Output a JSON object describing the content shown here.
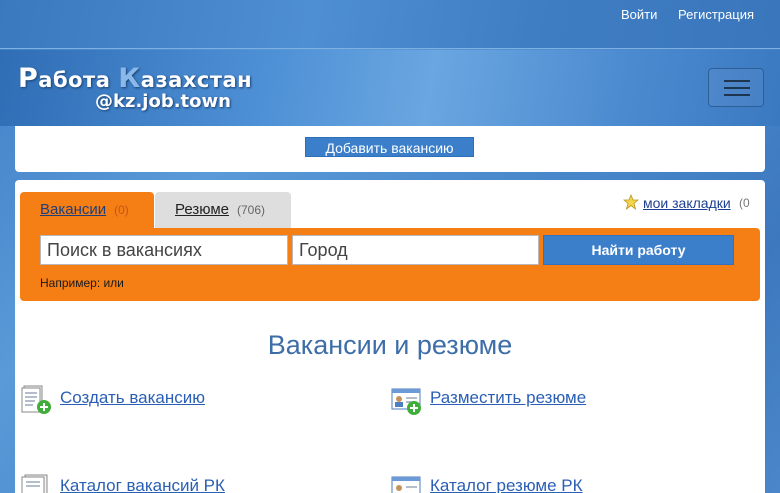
{
  "topbar": {
    "login": "Войти",
    "register": "Регистрация"
  },
  "logo": {
    "line1_first": "Р",
    "line1_rest_a": "абота ",
    "line1_k": "К",
    "line1_rest_b": "азахстан",
    "line2": "@kz.job.town"
  },
  "add_vacancy": {
    "label": "Добавить вакансию"
  },
  "tabs": [
    {
      "label": "Вакансии",
      "count": "(0)"
    },
    {
      "label": "Резюме",
      "count": "(706)"
    }
  ],
  "bookmarks": {
    "label": "мои закладки",
    "count": "(0"
  },
  "search": {
    "query_placeholder": "Поиск в вакансиях",
    "city_placeholder": "Город",
    "button": "Найти работу",
    "example": "Например:  или"
  },
  "page_title": "Вакансии и резюме",
  "actions": {
    "create_vacancy": "Создать вакансию",
    "post_resume": "Разместить резюме",
    "catalog_vacancies": "Каталог вакансий РК",
    "catalog_resumes": "Каталог резюме РК"
  },
  "icons": {
    "menu": "hamburger-icon",
    "star": "star-icon",
    "add_document": "add-document-icon",
    "add_resume": "add-resume-icon",
    "catalog": "catalog-icon",
    "resume_catalog": "resume-catalog-icon"
  },
  "colors": {
    "brand_blue": "#3b7fcb",
    "tab_orange": "#f57e15",
    "link_blue": "#2a5fb5",
    "title_blue": "#3e6ea8"
  }
}
